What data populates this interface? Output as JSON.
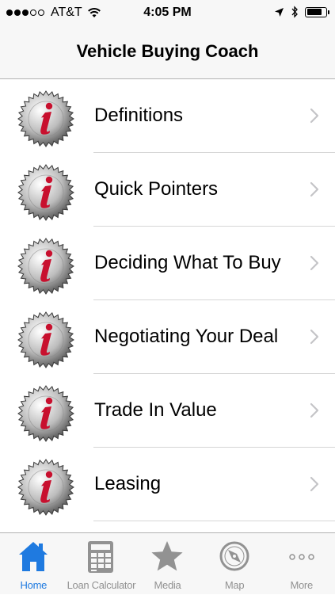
{
  "status_bar": {
    "carrier": "AT&T",
    "time": "4:05 PM",
    "signal_strength": 3,
    "signal_max": 5,
    "battery_level": 0.85
  },
  "nav": {
    "title": "Vehicle Buying Coach"
  },
  "list": {
    "items": [
      {
        "label": "Definitions",
        "icon": "info-seal-icon"
      },
      {
        "label": "Quick Pointers",
        "icon": "info-seal-icon"
      },
      {
        "label": "Deciding What To Buy",
        "icon": "info-seal-icon"
      },
      {
        "label": "Negotiating Your Deal",
        "icon": "info-seal-icon"
      },
      {
        "label": "Trade In Value",
        "icon": "info-seal-icon"
      },
      {
        "label": "Leasing",
        "icon": "info-seal-icon"
      }
    ]
  },
  "tab_bar": {
    "active": "Home",
    "tabs": [
      {
        "label": "Home",
        "icon": "home-icon"
      },
      {
        "label": "Loan Calculator",
        "icon": "calculator-icon"
      },
      {
        "label": "Media",
        "icon": "star-icon"
      },
      {
        "label": "Map",
        "icon": "compass-icon"
      },
      {
        "label": "More",
        "icon": "more-icon"
      }
    ]
  },
  "colors": {
    "accent": "#1f7ae0",
    "inactive": "#929292",
    "info_red": "#c8102e"
  }
}
